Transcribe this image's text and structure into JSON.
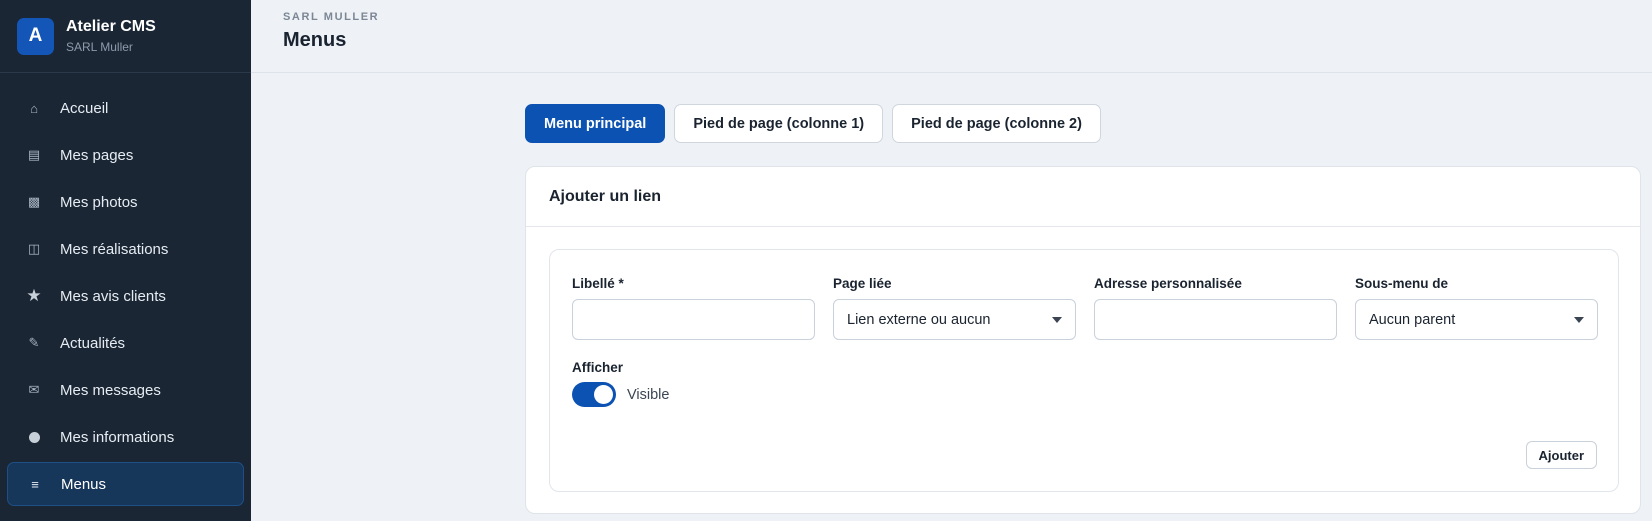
{
  "brand": {
    "logo_letter": "A",
    "app_name": "Atelier CMS",
    "org_name": "SARL Muller"
  },
  "sidebar": {
    "items": [
      {
        "label": "Accueil",
        "icon": "home-icon",
        "glyph": "⌂"
      },
      {
        "label": "Mes pages",
        "icon": "pages-icon",
        "glyph": "▤"
      },
      {
        "label": "Mes photos",
        "icon": "photos-icon",
        "glyph": "▩"
      },
      {
        "label": "Mes réalisations",
        "icon": "portfolio-icon",
        "glyph": "◫"
      },
      {
        "label": "Mes avis clients",
        "icon": "star-icon",
        "glyph": "★"
      },
      {
        "label": "Actualités",
        "icon": "pencil-icon",
        "glyph": "✎"
      },
      {
        "label": "Mes messages",
        "icon": "mail-icon",
        "glyph": "✉"
      },
      {
        "label": "Mes informations",
        "icon": "info-icon",
        "glyph": ""
      },
      {
        "label": "Menus",
        "icon": "menu-icon",
        "glyph": "≡"
      }
    ],
    "active_item": "Menus"
  },
  "header": {
    "breadcrumb": "SARL MULLER",
    "title": "Menus"
  },
  "tabs": [
    {
      "label": "Menu principal",
      "active": true
    },
    {
      "label": "Pied de page (colonne 1)",
      "active": false
    },
    {
      "label": "Pied de page (colonne 2)",
      "active": false
    }
  ],
  "form": {
    "title": "Ajouter un lien",
    "fields": {
      "label": {
        "label": "Libellé *",
        "value": ""
      },
      "page": {
        "label": "Page liée",
        "selected": "Lien externe ou aucun"
      },
      "url": {
        "label": "Adresse personnalisée",
        "value": ""
      },
      "parent": {
        "label": "Sous-menu de",
        "selected": "Aucun parent"
      }
    },
    "visibility": {
      "label": "Afficher",
      "toggle_text": "Visible",
      "enabled": true
    },
    "submit_label": "Ajouter"
  },
  "colors": {
    "sidebar_bg": "#1a2634",
    "accent": "#0c52b2",
    "page_bg": "#eef1f5"
  }
}
